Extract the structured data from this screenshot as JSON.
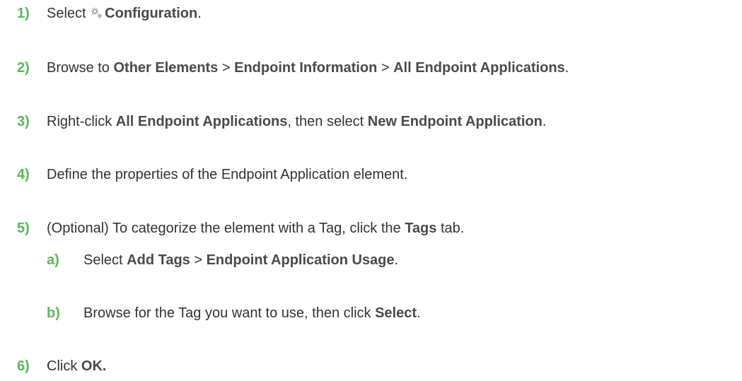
{
  "steps": [
    {
      "number": "1)",
      "parts": {
        "t1": "Select ",
        "icon": "gear-icon",
        "b1": "Configuration",
        "t2": "."
      }
    },
    {
      "number": "2)",
      "parts": {
        "t1": "Browse to ",
        "b1": "Other Elements",
        "t2": " > ",
        "b2": "Endpoint Information",
        "t3": " > ",
        "b3": "All Endpoint Applications",
        "t4": "."
      }
    },
    {
      "number": "3)",
      "parts": {
        "t1": "Right-click ",
        "b1": "All Endpoint Applications",
        "t2": ", then select ",
        "b2": "New Endpoint Application",
        "t3": "."
      }
    },
    {
      "number": "4)",
      "parts": {
        "t1": "Define the properties of the Endpoint Application element."
      }
    },
    {
      "number": "5)",
      "parts": {
        "t1": "(Optional) To categorize the element with a Tag, click the ",
        "b1": "Tags",
        "t2": " tab."
      },
      "substeps": [
        {
          "number": "a)",
          "parts": {
            "t1": "Select ",
            "b1": "Add Tags",
            "t2": " > ",
            "b2": "Endpoint Application Usage",
            "t3": "."
          }
        },
        {
          "number": "b)",
          "parts": {
            "t1": "Browse for the Tag you want to use, then click ",
            "b1": "Select",
            "t2": "."
          }
        }
      ]
    },
    {
      "number": "6)",
      "parts": {
        "t1": "Click ",
        "b1": "OK."
      }
    }
  ],
  "colors": {
    "step_number": "#5cb85c",
    "text": "#333333"
  }
}
